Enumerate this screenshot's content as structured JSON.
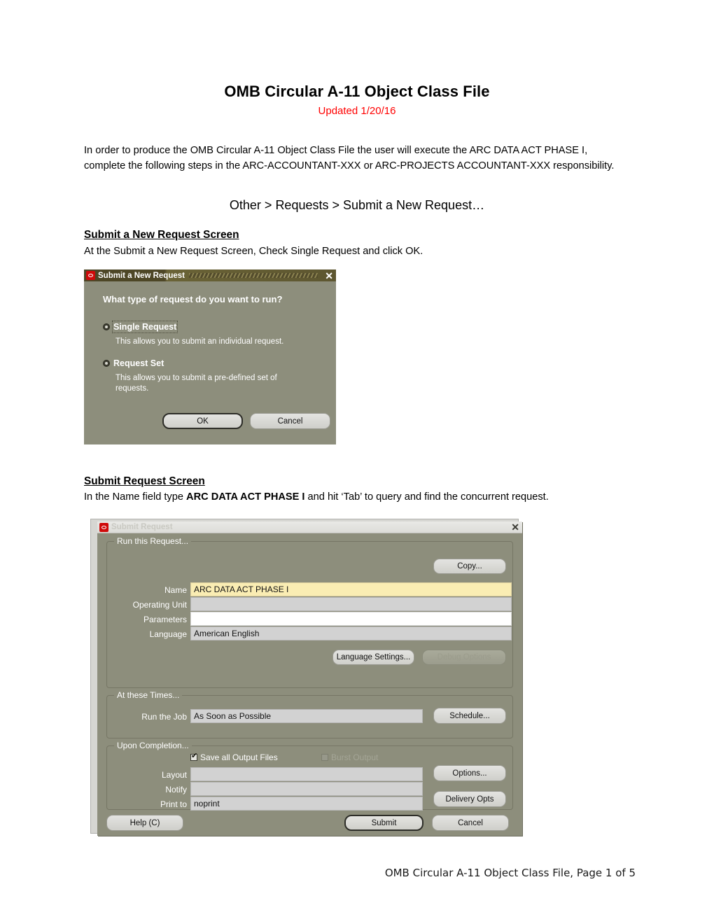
{
  "document": {
    "title": "OMB Circular A-11 Object Class File",
    "subtitle": "Updated 1/20/16",
    "subtitle_color": "#ff0000",
    "intro_paragraph": "In order to produce the OMB Circular A-11 Object Class File the user will execute the ARC DATA ACT PHASE I, complete the following steps in the ARC-ACCOUNTANT-XXX or ARC-PROJECTS ACCOUNTANT-XXX responsibility.",
    "nav_path": "Other > Requests > Submit a New Request…",
    "section_1": {
      "heading": "Submit a New Request Screen",
      "instruction": "At the Submit a New Request Screen, Check Single Request and click OK."
    },
    "section_2": {
      "heading": "Submit Request Screen",
      "instruction_prefix": "In the Name field type ",
      "instruction_bold": "ARC DATA ACT PHASE I",
      "instruction_suffix": " and hit ‘Tab’ to query and find the concurrent request."
    },
    "footer": "OMB Circular A-11 Object Class File, Page 1 of 5"
  },
  "dialog_new_request": {
    "titlebar": {
      "logo_icon": "oracle-logo-icon",
      "title": "Submit a New Request",
      "close_icon": "close-icon"
    },
    "question": "What type of request do you want to run?",
    "options": [
      {
        "label": "Single Request",
        "description": "This allows you to submit an individual request.",
        "selected": true,
        "focused": true
      },
      {
        "label": "Request Set",
        "description": "This allows you to submit a pre-defined set of requests.",
        "selected": true,
        "focused": false
      }
    ],
    "buttons": {
      "ok": "OK",
      "cancel": "Cancel"
    }
  },
  "dialog_submit_request": {
    "titlebar": {
      "logo_icon": "oracle-logo-icon",
      "title": "Submit Request",
      "close_icon": "close-icon"
    },
    "group_run": {
      "title": "Run this Request...",
      "copy_button": "Copy...",
      "fields": [
        {
          "label": "Name",
          "value": "ARC DATA ACT PHASE I",
          "state": "focus"
        },
        {
          "label": "Operating Unit",
          "value": "",
          "state": "normal"
        },
        {
          "label": "Parameters",
          "value": "",
          "state": "white"
        },
        {
          "label": "Language",
          "value": "American English",
          "state": "normal"
        }
      ],
      "language_settings_button": "Language Settings...",
      "debug_options_button": "Debug Options"
    },
    "group_times": {
      "title": "At these Times...",
      "run_job_label": "Run the Job",
      "run_job_value": "As Soon as Possible",
      "schedule_button": "Schedule..."
    },
    "group_completion": {
      "title": "Upon Completion...",
      "save_all_output_files": {
        "label": "Save all Output Files",
        "checked": true
      },
      "burst_output": {
        "label": "Burst Output",
        "checked": false,
        "disabled": true
      },
      "fields": [
        {
          "label": "Layout",
          "value": ""
        },
        {
          "label": "Notify",
          "value": ""
        },
        {
          "label": "Print to",
          "value": "noprint"
        }
      ],
      "options_button": "Options...",
      "delivery_opts_button": "Delivery Opts"
    },
    "buttons": {
      "help": "Help (C)",
      "submit": "Submit",
      "cancel": "Cancel"
    }
  },
  "colors": {
    "dialog_bg": "#8d8e7c",
    "titlebar_active": "#4d4626",
    "titlebar_inactive": "#e4e4e1",
    "oracle_red": "#cf0a0a",
    "field_normal": "#d2d2d2",
    "field_focus": "#faedb3",
    "accent_red": "#ff0000"
  }
}
